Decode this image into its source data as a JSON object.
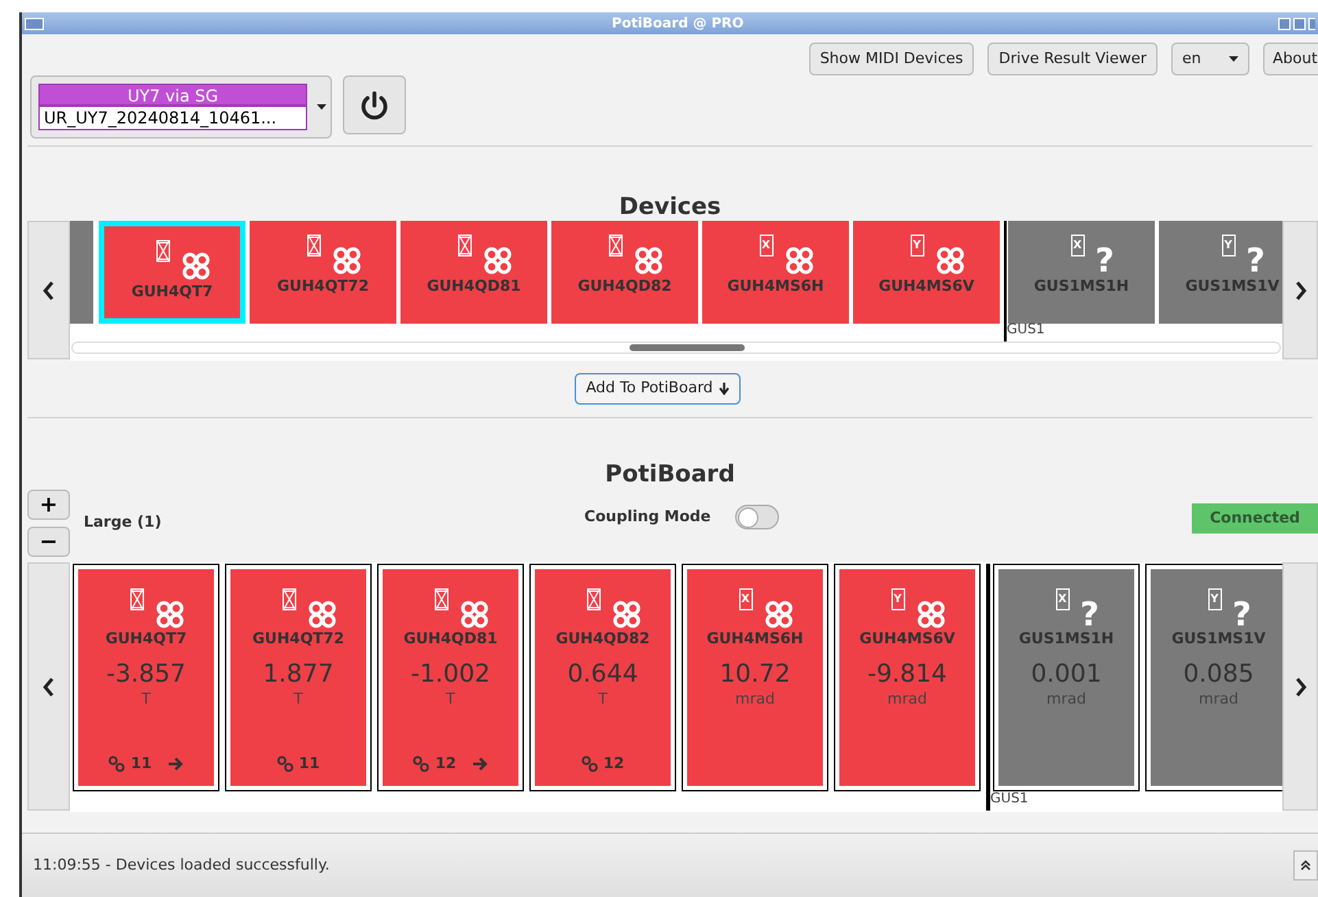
{
  "window": {
    "title": "PotiBoard @ PRO"
  },
  "toolbar": {
    "buttons": [
      "Show MIDI Devices",
      "Drive Result Viewer"
    ],
    "language": "en",
    "about": "About"
  },
  "source_combo": {
    "header": "UY7 via SG",
    "value": "UR_UY7_20240814_10461..."
  },
  "devices_section": {
    "title": "Devices",
    "add_button": "Add To PotiBoard",
    "items": [
      {
        "kind": "quadrupole",
        "name": "GUH4QT7",
        "coupled": true,
        "selected": true
      },
      {
        "kind": "quadrupole",
        "name": "GUH4QT72",
        "coupled": true,
        "selected": false
      },
      {
        "kind": "quadrupole",
        "name": "GUH4QD81",
        "coupled": true,
        "selected": false
      },
      {
        "kind": "quadrupole",
        "name": "GUH4QD82",
        "coupled": true,
        "selected": false
      },
      {
        "kind": "steerer",
        "name": "GUH4MS6H",
        "coupled": true,
        "axis": "X",
        "selected": false
      },
      {
        "kind": "steerer",
        "name": "GUH4MS6V",
        "coupled": true,
        "axis": "Y",
        "selected": false
      },
      {
        "kind": "group",
        "label": "GUS1"
      },
      {
        "kind": "steerer",
        "name": "GUS1MS1H",
        "coupled": false,
        "status_glyph": "?",
        "axis": "X",
        "selected": false
      },
      {
        "kind": "steerer",
        "name": "GUS1MS1V",
        "coupled": false,
        "status_glyph": "?",
        "axis": "Y",
        "selected": false
      }
    ]
  },
  "potiboard": {
    "title": "PotiBoard",
    "zoom_in": "+",
    "zoom_out": "−",
    "size_label": "Large (1)",
    "coupling_mode": {
      "label": "Coupling Mode",
      "on": false
    },
    "connection": "Connected",
    "items": [
      {
        "kind": "quadrupole",
        "name": "GUH4QT7",
        "coupled": true,
        "value": "-3.857",
        "unit": "T",
        "link_count": "11",
        "has_next": true
      },
      {
        "kind": "quadrupole",
        "name": "GUH4QT72",
        "coupled": true,
        "value": "1.877",
        "unit": "T",
        "link_count": "11",
        "has_next": false
      },
      {
        "kind": "quadrupole",
        "name": "GUH4QD81",
        "coupled": true,
        "value": "-1.002",
        "unit": "T",
        "link_count": "12",
        "has_next": true
      },
      {
        "kind": "quadrupole",
        "name": "GUH4QD82",
        "coupled": true,
        "value": "0.644",
        "unit": "T",
        "link_count": "12",
        "has_next": false
      },
      {
        "kind": "steerer",
        "name": "GUH4MS6H",
        "coupled": true,
        "axis": "X",
        "value": "10.72",
        "unit": "mrad"
      },
      {
        "kind": "steerer",
        "name": "GUH4MS6V",
        "coupled": true,
        "axis": "Y",
        "value": "-9.814",
        "unit": "mrad"
      },
      {
        "kind": "group",
        "label": "GUS1"
      },
      {
        "kind": "steerer",
        "name": "GUS1MS1H",
        "coupled": false,
        "status_glyph": "?",
        "axis": "X",
        "value": "0.001",
        "unit": "mrad"
      },
      {
        "kind": "steerer",
        "name": "GUS1MS1V",
        "coupled": false,
        "status_glyph": "?",
        "axis": "Y",
        "value": "0.085",
        "unit": "mrad"
      }
    ]
  },
  "status_bar": {
    "message": "11:09:55 - Devices loaded successfully."
  }
}
